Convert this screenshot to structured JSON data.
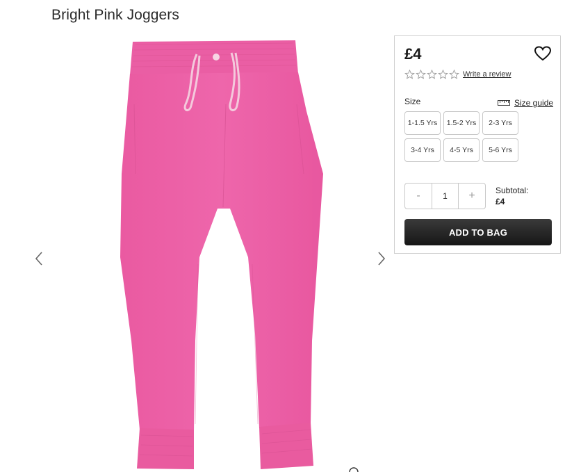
{
  "product": {
    "title": "Bright Pink Joggers",
    "image_alt": "Bright Pink Joggers",
    "color": "#ec5fa5"
  },
  "gallery": {
    "prev_icon": "chevron-left-icon",
    "next_icon": "chevron-right-icon"
  },
  "purchase": {
    "price": "£4",
    "wishlist_icon": "heart-icon",
    "rating": {
      "stars": 5,
      "filled": 0,
      "icon": "star-outline-icon"
    },
    "write_review_label": "Write a review",
    "size_label": "Size",
    "size_guide_label": "Size guide",
    "size_guide_icon": "ruler-icon",
    "sizes": [
      "1-1.5 Yrs",
      "1.5-2 Yrs",
      "2-3 Yrs",
      "3-4 Yrs",
      "4-5 Yrs",
      "5-6 Yrs"
    ],
    "quantity": {
      "decrement": "-",
      "value": "1",
      "increment": "+"
    },
    "subtotal_label": "Subtotal:",
    "subtotal_value": "£4",
    "add_to_bag_label": "ADD TO BAG",
    "accent": "#1e1e1e"
  }
}
